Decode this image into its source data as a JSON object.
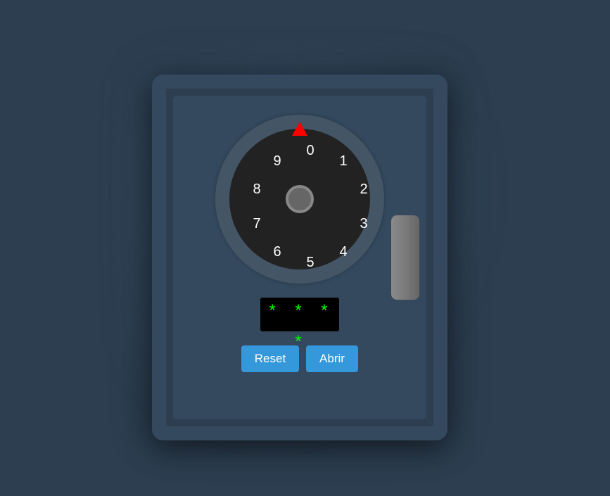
{
  "dial": {
    "numbers": [
      "0",
      "1",
      "2",
      "3",
      "4",
      "5",
      "6",
      "7",
      "8",
      "9"
    ]
  },
  "display": {
    "code": "* * * *"
  },
  "buttons": {
    "reset_label": "Reset",
    "open_label": "Abrir"
  },
  "colors": {
    "background": "#2c3e50",
    "safe_body": "#34495e",
    "dial": "#222222",
    "pointer": "#ff0000",
    "display_text": "#00ff00",
    "button": "#3498db"
  },
  "icons": {
    "pointer": "triangle-pointer-icon",
    "dial_knob": "dial-knob-icon",
    "handle": "safe-handle"
  }
}
